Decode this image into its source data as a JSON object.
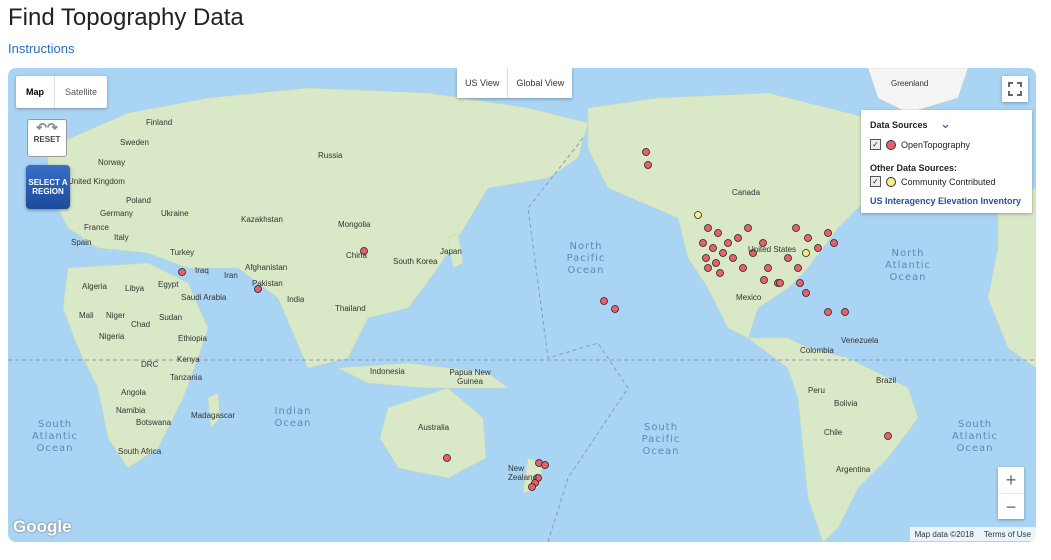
{
  "page": {
    "title": "Find Topography Data",
    "instructions_link": "Instructions"
  },
  "map_controls": {
    "map_type": [
      "Map",
      "Satellite"
    ],
    "view_buttons": [
      "US View",
      "Global View"
    ],
    "reset_label": "RESET",
    "select_region_label": "SELECT A REGION",
    "zoom_in": "+",
    "zoom_out": "−"
  },
  "legend": {
    "title": "Data Sources",
    "opentopo_label": "OpenTopography",
    "other_title": "Other Data Sources:",
    "community_label": "Community Contributed",
    "inventory_link": "US Interagency Elevation Inventory",
    "colors": {
      "opentopography": "#e8606a",
      "community": "#f2ef8c"
    }
  },
  "map_labels": {
    "countries": [
      "Greenland",
      "Finland",
      "Sweden",
      "Norway",
      "United Kingdom",
      "Poland",
      "Germany",
      "Ukraine",
      "France",
      "Italy",
      "Spain",
      "Russia",
      "Kazakhstan",
      "Mongolia",
      "China",
      "Japan",
      "South Korea",
      "Turkey",
      "Iraq",
      "Iran",
      "Afghanistan",
      "Pakistan",
      "Egypt",
      "Saudi Arabia",
      "India",
      "Algeria",
      "Libya",
      "Mali",
      "Niger",
      "Chad",
      "Sudan",
      "Nigeria",
      "Ethiopia",
      "DRC",
      "Kenya",
      "Tanzania",
      "Angola",
      "Namibia",
      "Botswana",
      "South Africa",
      "Madagascar",
      "Thailand",
      "Indonesia",
      "Papua New Guinea",
      "Australia",
      "New Zealand",
      "Canada",
      "United States",
      "Mexico",
      "Venezuela",
      "Colombia",
      "Peru",
      "Brazil",
      "Bolivia",
      "Chile",
      "Argentina"
    ],
    "oceans": {
      "north_pacific": "North Pacific Ocean",
      "north_atlantic": "North Atlantic Ocean",
      "south_atlantic_left": "South Atlantic Ocean",
      "indian": "Indian Ocean",
      "south_pacific": "South Pacific Ocean",
      "south_atlantic_right": "South Atlantic Ocean"
    }
  },
  "attribution": {
    "logo": "Google",
    "map_data": "Map data ©2018",
    "terms": "Terms of Use"
  }
}
